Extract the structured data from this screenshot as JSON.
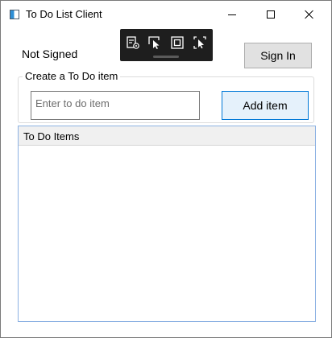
{
  "window": {
    "title": "To Do List Client"
  },
  "icons": {
    "app": "app-icon",
    "minimize": "minimize-icon",
    "maximize": "maximize-icon",
    "close": "close-icon"
  },
  "debug_toolbar": {
    "buttons": [
      "live-visual-tree-icon",
      "select-element-icon",
      "display-adorners-icon",
      "track-focus-icon"
    ]
  },
  "auth": {
    "status": "Not Signed",
    "signin_label": "Sign In"
  },
  "create": {
    "group_label": "Create a To Do item",
    "input_placeholder": "Enter to do item",
    "add_label": "Add item"
  },
  "list": {
    "header": "To Do Items",
    "items": []
  },
  "colors": {
    "accent": "#0078d7",
    "button_bg": "#e1e1e1",
    "list_border": "#8db2e3"
  }
}
